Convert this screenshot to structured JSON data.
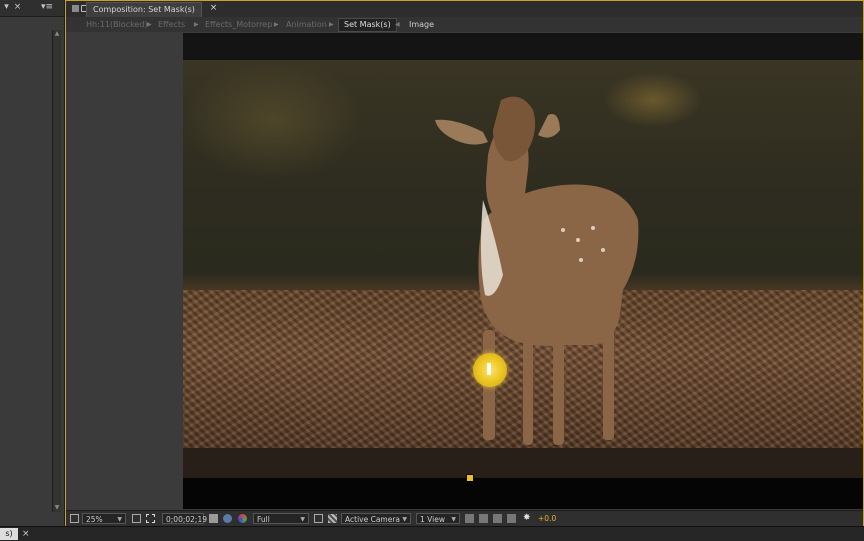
{
  "left_panel": {
    "menu_icon": "panel-menu-icon",
    "close_icon": "close-icon"
  },
  "composition_panel": {
    "tab_label": "Composition: Set Mask(s)",
    "tab_close": "×",
    "breadcrumbs": [
      {
        "label": "Hh:11(Blocked)"
      },
      {
        "label": "Effects"
      },
      {
        "label": "Effects_Motorrep"
      },
      {
        "label": "Animation"
      }
    ],
    "active_crumb": "Set Mask(s)",
    "current_layer": "Image"
  },
  "viewer_controls": {
    "zoom": "25%",
    "timecode": "0;00;02;19",
    "resolution": "Full",
    "view": "Active Camera",
    "layout": "1 View",
    "exposure": "+0.0"
  },
  "status_bar": {
    "left_label": "s)",
    "close": "×"
  },
  "colors": {
    "panel_highlight": "#c9a227",
    "accent_yellow": "#e9c21c"
  }
}
